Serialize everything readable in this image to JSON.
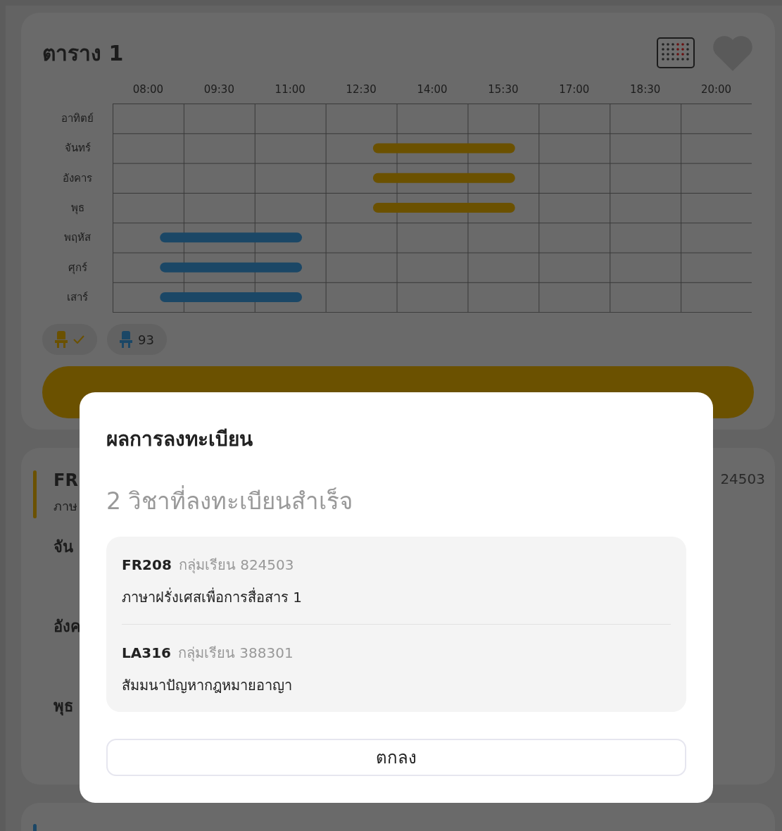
{
  "schedule_card": {
    "title": "ตาราง 1",
    "chart_data": {
      "type": "bar",
      "orientation": "horizontal",
      "categories": [
        "อาทิตย์",
        "จันทร์",
        "อังคาร",
        "พุธ",
        "พฤหัส",
        "ศุกร์",
        "เสาร์"
      ],
      "xticks": [
        {
          "value": 8,
          "label": "08:00"
        },
        {
          "value": 9.5,
          "label": "09:30"
        },
        {
          "value": 11,
          "label": "11:00"
        },
        {
          "value": 12.5,
          "label": "12:30"
        },
        {
          "value": 14,
          "label": "14:00"
        },
        {
          "value": 15.5,
          "label": "15:30"
        },
        {
          "value": 17,
          "label": "17:00"
        },
        {
          "value": 18.5,
          "label": "18:30"
        },
        {
          "value": 20,
          "label": "20:00"
        }
      ],
      "xlim": [
        7.25,
        20.75
      ],
      "series": [
        {
          "color": "#6b5100",
          "base": [
            null,
            12.75,
            12.75,
            12.75,
            null,
            null,
            null
          ],
          "values": [
            null,
            3,
            3,
            3,
            null,
            null,
            null
          ]
        },
        {
          "color": "#1b4766",
          "base": [
            null,
            null,
            null,
            null,
            8.25,
            8.25,
            8.25
          ],
          "values": [
            null,
            null,
            null,
            null,
            3,
            3,
            3
          ]
        }
      ]
    },
    "chips": [
      {
        "color": "#6b5100",
        "checked": true
      },
      {
        "color": "#1b4766",
        "label": "93"
      }
    ]
  },
  "course_card": {
    "code": "FR",
    "name": "ภาษ",
    "days": [
      "จัน",
      "อังค",
      "พุธ"
    ],
    "section": "24503"
  },
  "dialog": {
    "title": "ผลการลงทะเบียน",
    "subtitle": "2 วิชาที่ลงทะเบียนสำเร็จ",
    "courses": [
      {
        "code": "FR208",
        "section": "กลุ่มเรียน 824503",
        "name": "ภาษาฝรั่งเศสเพื่อการสื่อสาร 1"
      },
      {
        "code": "LA316",
        "section": "กลุ่มเรียน 388301",
        "name": "สัมมนาปัญหากฎหมายอาญา"
      }
    ],
    "button": "ตกลง"
  }
}
